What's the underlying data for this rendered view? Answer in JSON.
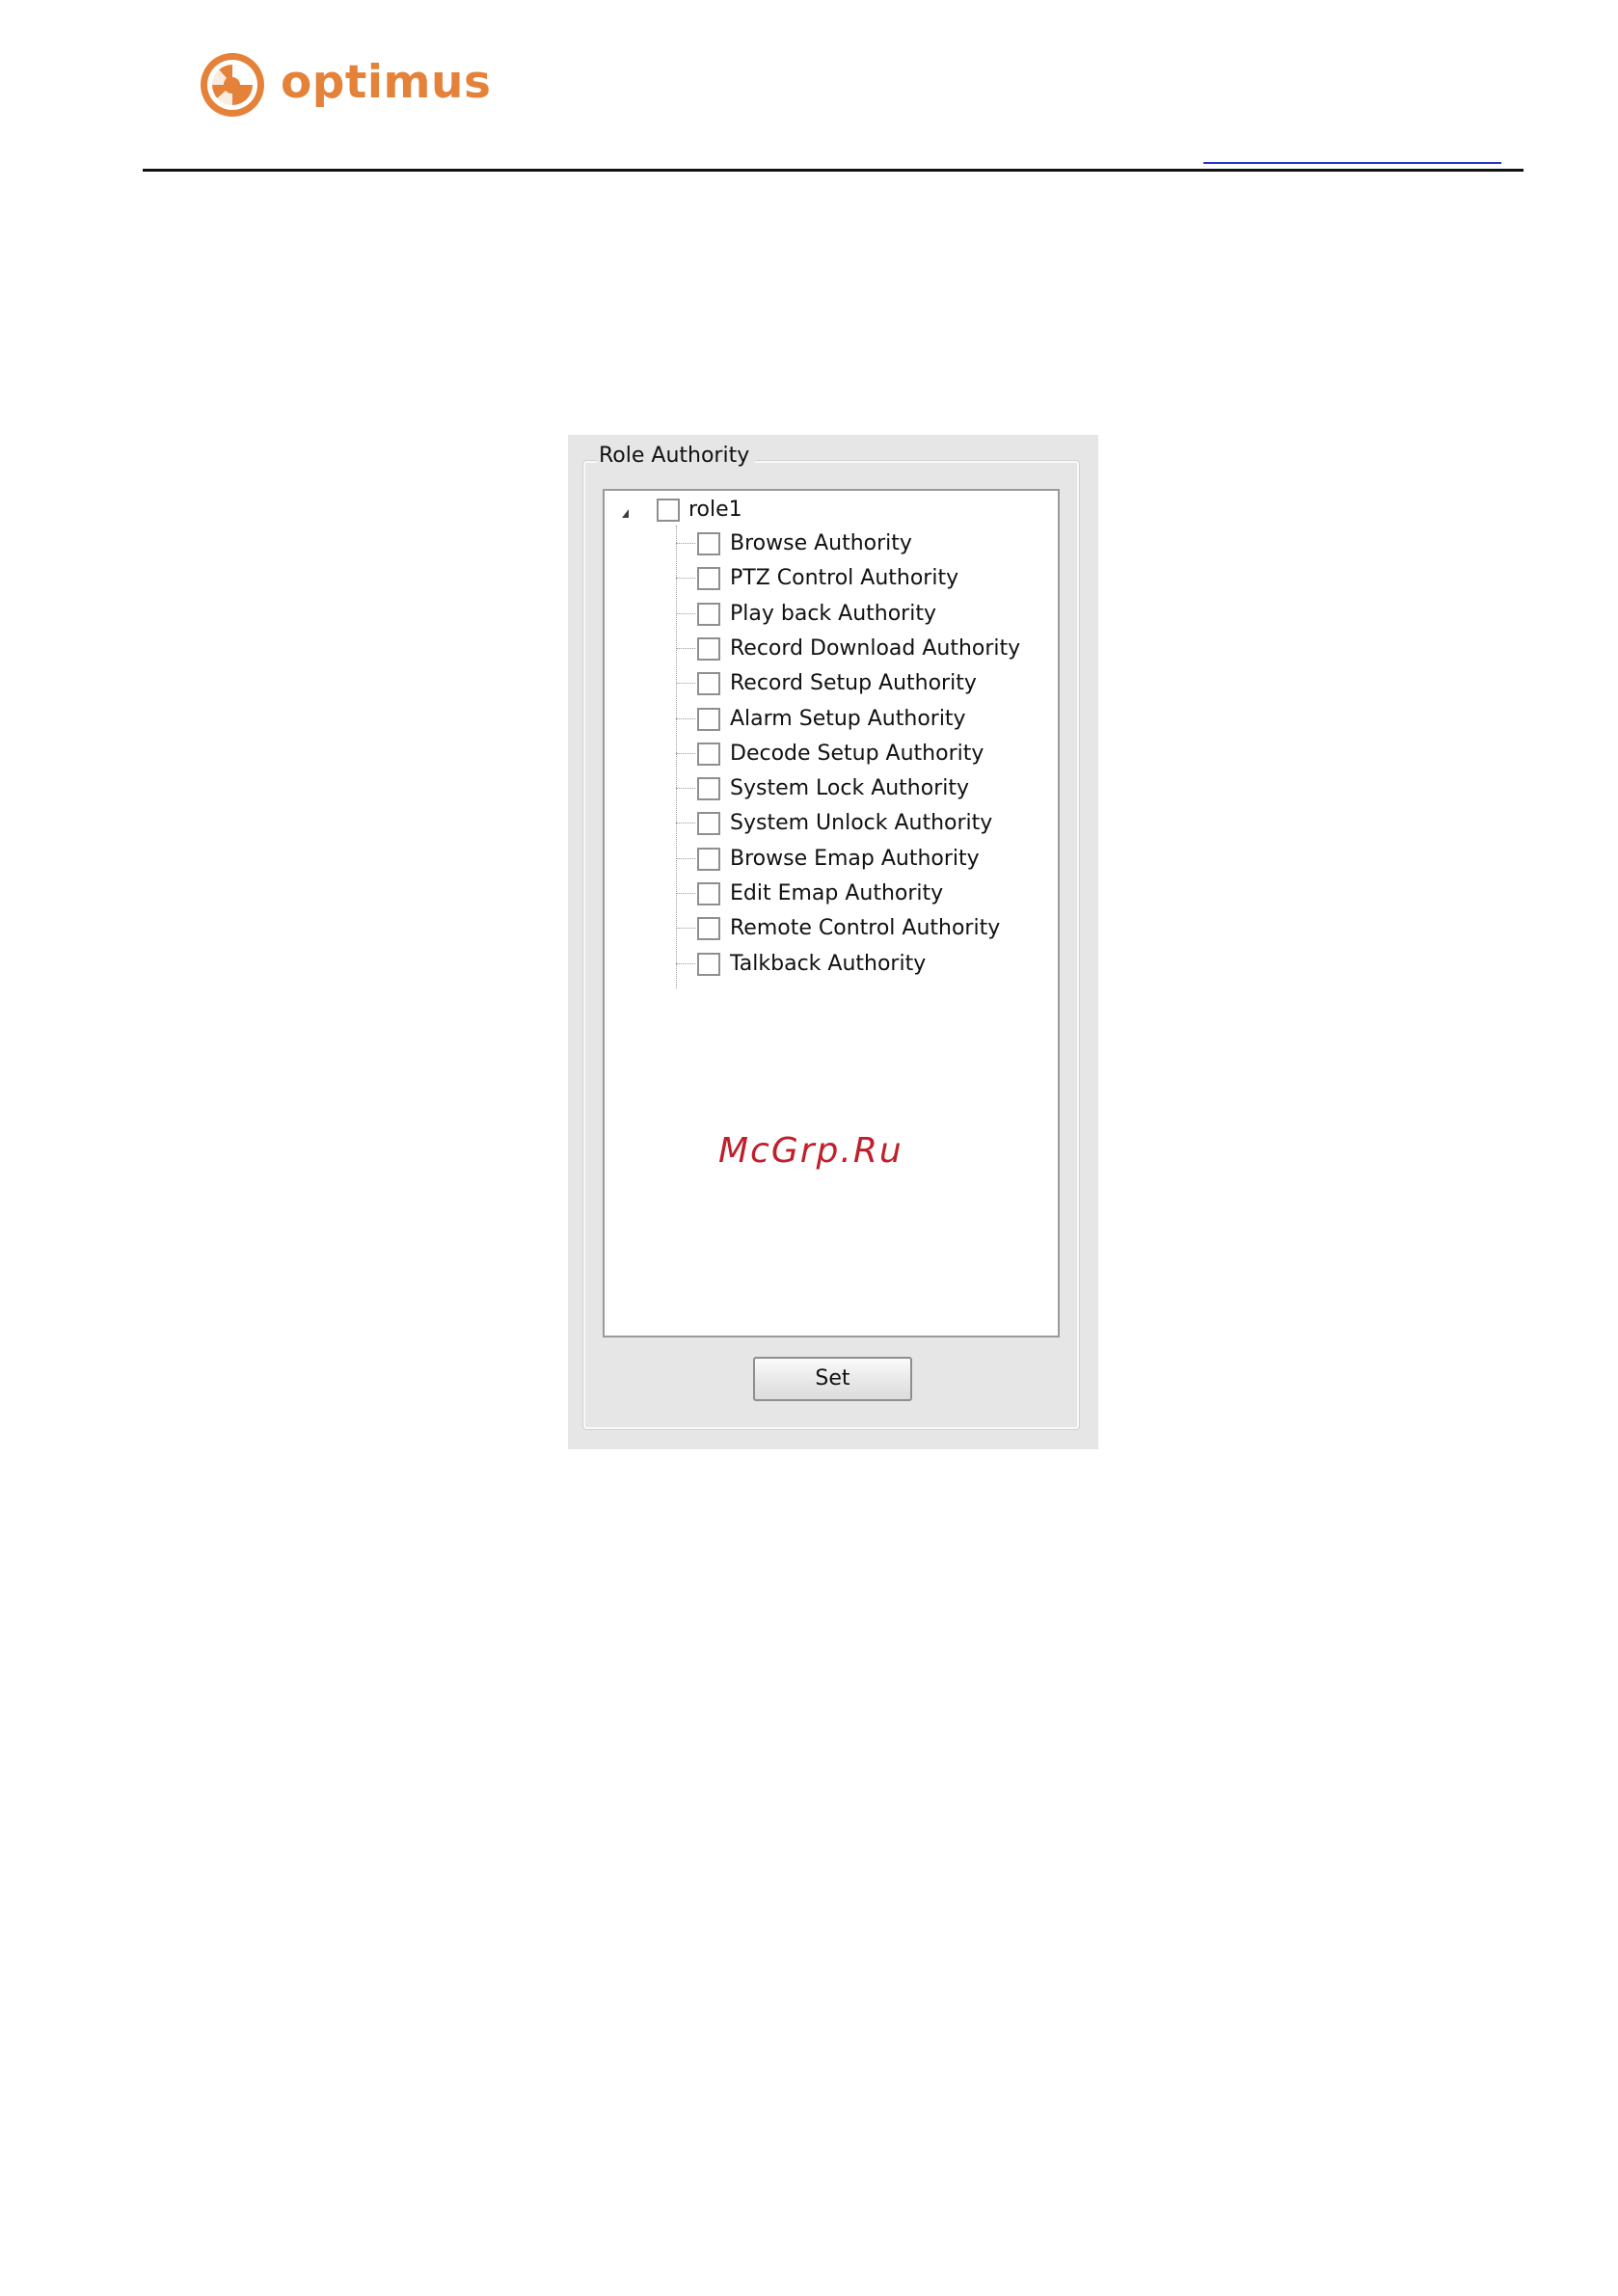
{
  "brand": {
    "name": "optimus",
    "color": "#e5823a"
  },
  "dialog": {
    "group_title": "Role Authority",
    "tree": {
      "root": {
        "label": "role1",
        "checked": false,
        "expanded": true
      },
      "items": [
        {
          "label": "Browse Authority",
          "checked": false
        },
        {
          "label": "PTZ Control Authority",
          "checked": false
        },
        {
          "label": "Play back Authority",
          "checked": false
        },
        {
          "label": "Record Download Authority",
          "checked": false
        },
        {
          "label": "Record Setup Authority",
          "checked": false
        },
        {
          "label": "Alarm Setup Authority",
          "checked": false
        },
        {
          "label": "Decode Setup Authority",
          "checked": false
        },
        {
          "label": "System Lock Authority",
          "checked": false
        },
        {
          "label": "System Unlock Authority",
          "checked": false
        },
        {
          "label": "Browse Emap Authority",
          "checked": false
        },
        {
          "label": "Edit Emap Authority",
          "checked": false
        },
        {
          "label": "Remote Control Authority",
          "checked": false
        },
        {
          "label": "Talkback Authority",
          "checked": false
        }
      ]
    },
    "set_button_label": "Set"
  },
  "watermark": {
    "text": "McGrp.Ru",
    "color": "#c0202a"
  }
}
